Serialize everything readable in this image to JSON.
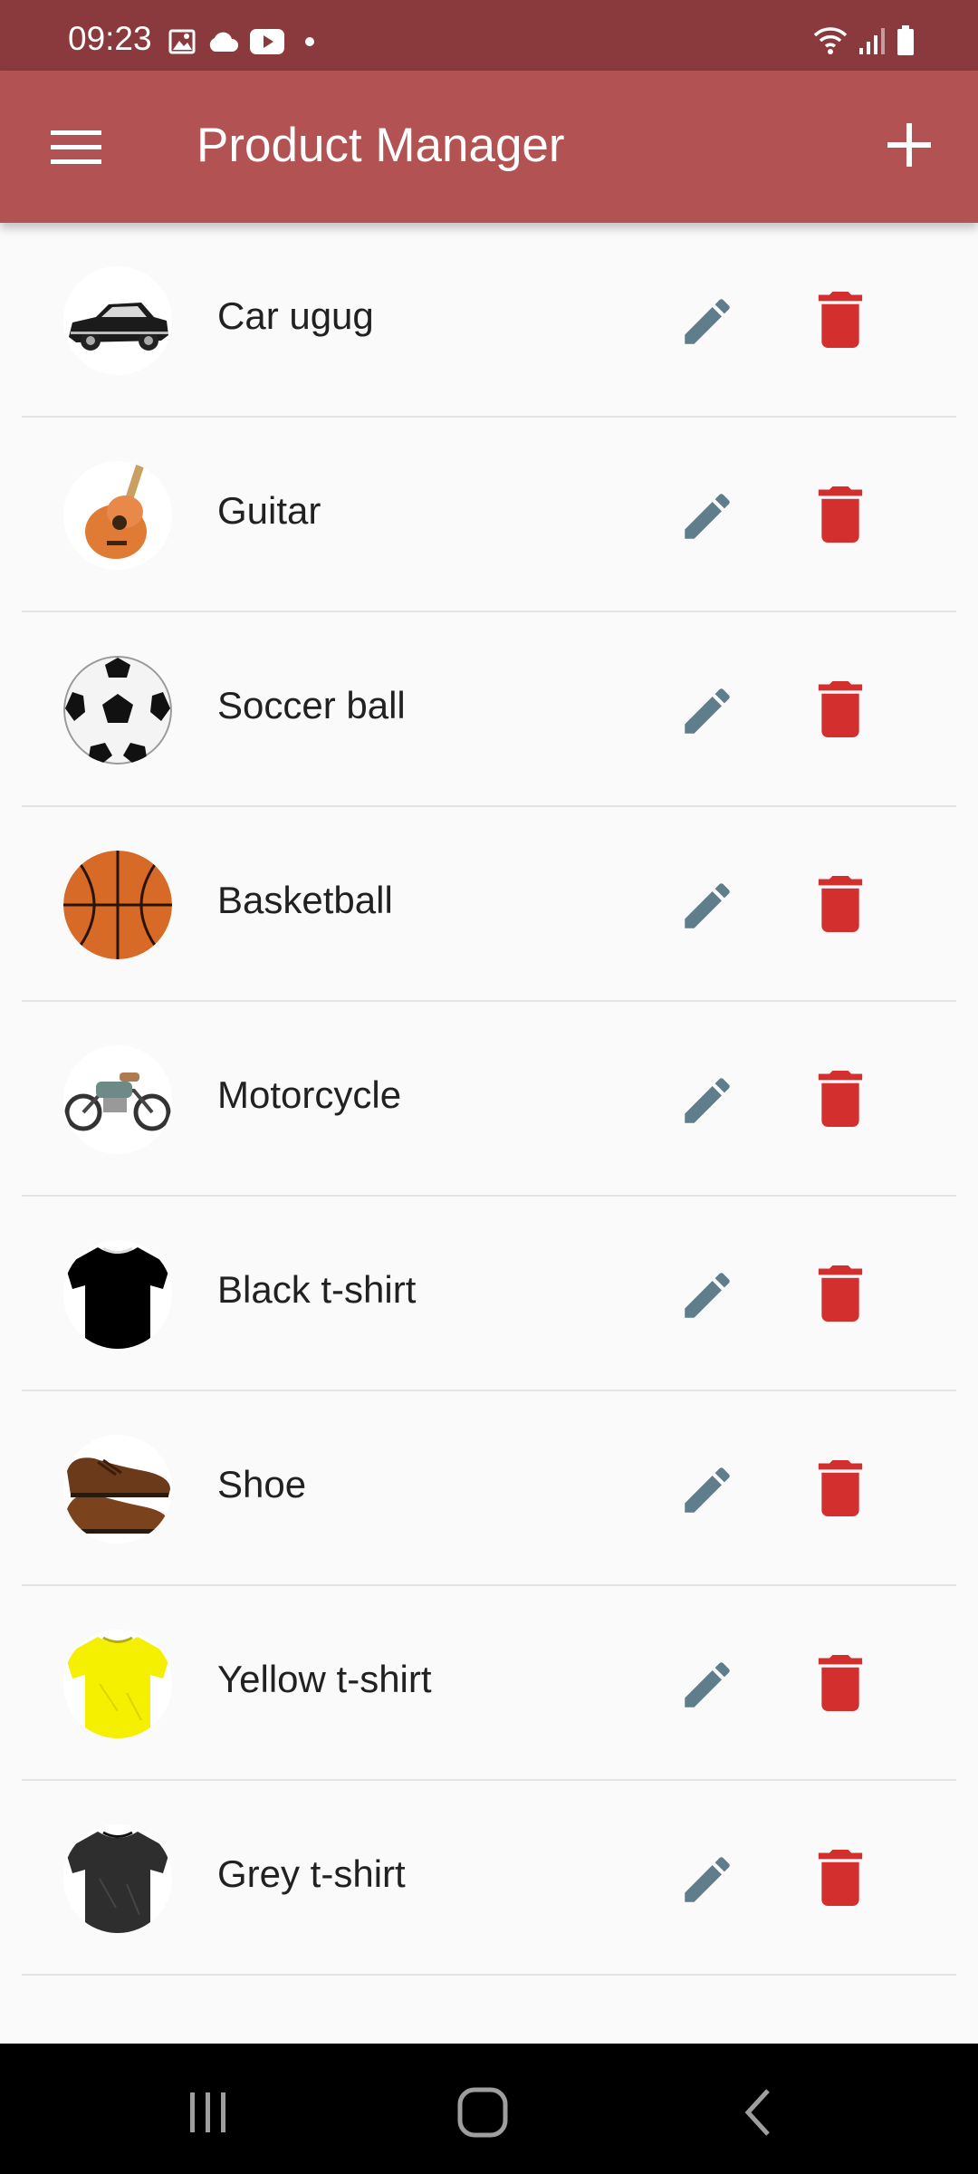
{
  "status_bar": {
    "time": "09:23",
    "left_icons": [
      "image-icon",
      "cloud-icon",
      "youtube-icon",
      "dot-icon"
    ],
    "right_icons": [
      "wifi-icon",
      "signal-icon",
      "battery-icon"
    ]
  },
  "app_bar": {
    "title": "Product Manager",
    "menu_icon": "hamburger-menu-icon",
    "add_icon": "plus-icon",
    "color": "#b35252"
  },
  "products": [
    {
      "name": "Car ugug",
      "image": "car-icon"
    },
    {
      "name": "Guitar",
      "image": "guitar-icon"
    },
    {
      "name": "Soccer ball",
      "image": "soccer-ball-icon"
    },
    {
      "name": "Basketball",
      "image": "basketball-icon"
    },
    {
      "name": "Motorcycle",
      "image": "motorcycle-icon"
    },
    {
      "name": "Black t-shirt",
      "image": "black-tshirt-icon"
    },
    {
      "name": "Shoe",
      "image": "shoe-icon"
    },
    {
      "name": "Yellow t-shirt",
      "image": "yellow-tshirt-icon"
    },
    {
      "name": "Grey t-shirt",
      "image": "grey-tshirt-icon"
    }
  ],
  "row_actions": {
    "edit_icon": "pencil-icon",
    "delete_icon": "trash-icon",
    "edit_color": "#607d8b",
    "delete_color": "#d32f2f"
  },
  "nav_bar": {
    "buttons": [
      "recent-apps-icon",
      "home-icon",
      "back-icon"
    ]
  }
}
